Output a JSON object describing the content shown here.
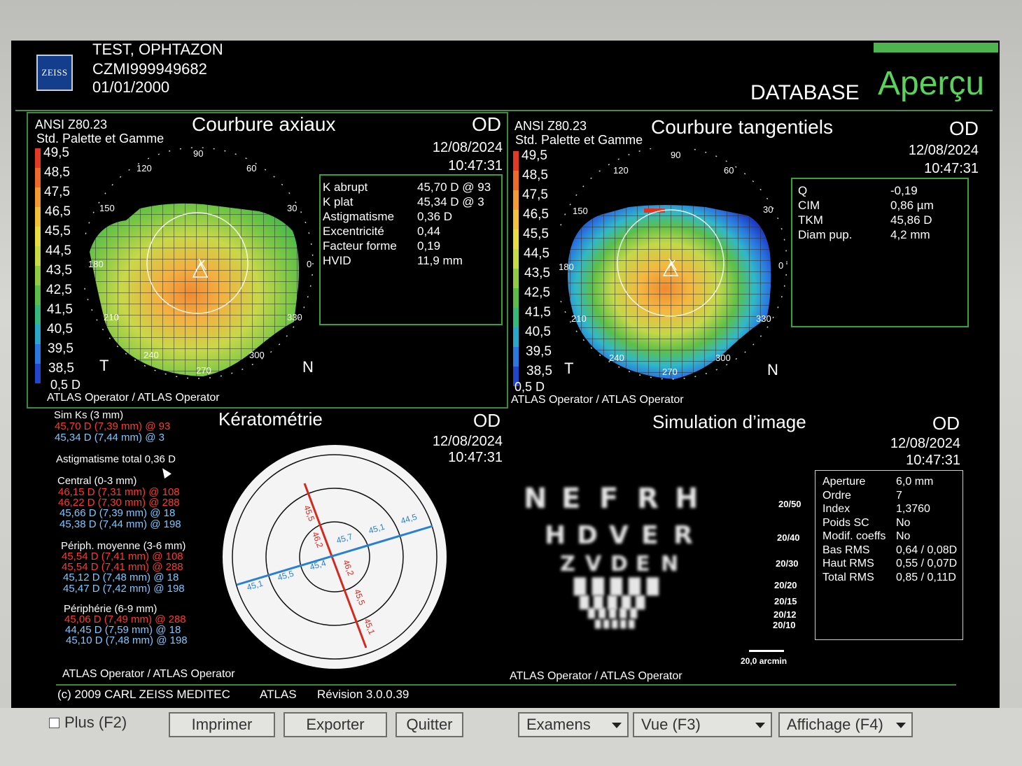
{
  "patient": {
    "name": "TEST, OPHTAZON",
    "id": "CZMI999949682",
    "dob": "01/01/2000"
  },
  "header": {
    "logo": "ZEISS",
    "database": "DATABASE",
    "mode": "Aperçu"
  },
  "axial": {
    "standard": "ANSI Z80.23",
    "palette": "Std. Palette et Gamme",
    "title": "Courbure axiaux",
    "eye": "OD",
    "date": "12/08/2024",
    "time": "10:47:31",
    "scale_labels": [
      "49,5",
      "48,5",
      "47,5",
      "46,5",
      "45,5",
      "44,5",
      "43,5",
      "42,5",
      "41,5",
      "40,5",
      "39,5",
      "38,5"
    ],
    "step": "0,5 D",
    "angles": [
      "90",
      "60",
      "30",
      "0",
      "330",
      "300",
      "270",
      "240",
      "210",
      "180",
      "150",
      "120"
    ],
    "temporal": "T",
    "nasal": "N",
    "info": [
      {
        "label": "K abrupt",
        "value": "45,70 D @ 93"
      },
      {
        "label": "K plat",
        "value": "45,34 D @ 3"
      },
      {
        "label": "Astigmatisme",
        "value": "0,36 D"
      },
      {
        "label": "Excentricité",
        "value": "0,44"
      },
      {
        "label": "Facteur forme",
        "value": "0,19"
      },
      {
        "label": "HVID",
        "value": "11,9 mm"
      }
    ],
    "operator": "ATLAS Operator / ATLAS Operator"
  },
  "tangential": {
    "standard": "ANSI Z80.23",
    "palette": "Std. Palette et Gamme",
    "title": "Courbure tangentiels",
    "eye": "OD",
    "date": "12/08/2024",
    "time": "10:47:31",
    "scale_labels": [
      "49,5",
      "48,5",
      "47,5",
      "46,5",
      "45,5",
      "44,5",
      "43,5",
      "42,5",
      "41,5",
      "40,5",
      "39,5",
      "38,5"
    ],
    "step": "0,5 D",
    "angles": [
      "90",
      "60",
      "30",
      "0",
      "330",
      "300",
      "270",
      "240",
      "210",
      "180",
      "150",
      "120"
    ],
    "temporal": "T",
    "nasal": "N",
    "info": [
      {
        "label": "Q",
        "value": "-0,19"
      },
      {
        "label": "CIM",
        "value": "0,86 µm"
      },
      {
        "label": "TKM",
        "value": "45,86 D"
      },
      {
        "label": "Diam pup.",
        "value": "4,2 mm"
      }
    ],
    "operator": "ATLAS Operator / ATLAS Operator"
  },
  "kerato": {
    "title": "Kératométrie",
    "eye": "OD",
    "date": "12/08/2024",
    "time": "10:47:31",
    "simk_title": "Sim Ks (3 mm)",
    "simk_steep": "45,70 D (7,39 mm) @ 93",
    "simk_flat": "45,34 D (7,44 mm) @ 3",
    "astig_total": "Astigmatisme total 0,36 D",
    "central_title": "Central (0-3 mm)",
    "central": [
      "46,15 D (7,31 mm) @ 108",
      "46,22 D (7,30 mm) @ 288",
      "45,66 D (7,39 mm) @ 18",
      "45,38 D (7,44 mm) @ 198"
    ],
    "periph_mid_title": "Périph. moyenne (3-6 mm)",
    "periph_mid": [
      "45,54 D (7,41 mm) @ 108",
      "45,54 D (7,41 mm) @ 288",
      "45,12 D (7,48 mm) @ 18",
      "45,47 D (7,42 mm) @ 198"
    ],
    "periph_title": "Périphérie (6-9 mm)",
    "periph": [
      "45,06 D (7,49 mm) @ 288",
      "44,45 D (7,59 mm) @ 18",
      "45,10 D (7,48 mm) @ 198"
    ],
    "diagram_labels": {
      "red": [
        "45,5",
        "46,2",
        "46,2",
        "45,5",
        "45,1"
      ],
      "blue": [
        "45,1",
        "45,5",
        "45,4",
        "45,7",
        "45,1",
        "44,5"
      ]
    },
    "operator": "ATLAS Operator / ATLAS Operator"
  },
  "simulation": {
    "title": "Simulation d’image",
    "eye": "OD",
    "date": "12/08/2024",
    "time": "10:47:31",
    "rows": [
      {
        "acuity": "20/50",
        "letters": "NEFRH"
      },
      {
        "acuity": "20/40",
        "letters": "HDVER"
      },
      {
        "acuity": "20/30",
        "letters": "ZVDEN"
      },
      {
        "acuity": "20/20",
        "letters": ""
      },
      {
        "acuity": "20/15",
        "letters": ""
      },
      {
        "acuity": "20/12",
        "letters": ""
      },
      {
        "acuity": "20/10",
        "letters": ""
      }
    ],
    "scale_bar": "20,0 arcmin",
    "info": [
      {
        "label": "Aperture",
        "value": "6,0 mm"
      },
      {
        "label": "Ordre",
        "value": "7"
      },
      {
        "label": "Index",
        "value": "1,3760"
      },
      {
        "label": "Poids SC",
        "value": "No"
      },
      {
        "label": "Modif. coeffs",
        "value": "No"
      },
      {
        "label": "Bas RMS",
        "value": "0,64 / 0,08D"
      },
      {
        "label": "Haut RMS",
        "value": "0,55 / 0,07D"
      },
      {
        "label": "Total RMS",
        "value": "0,85 / 0,11D"
      }
    ],
    "operator": "ATLAS Operator / ATLAS Operator"
  },
  "footer": {
    "copyright": "(c) 2009 CARL ZEISS MEDITEC",
    "product": "ATLAS",
    "revision": "Révision  3.0.0.39"
  },
  "toolbar": {
    "plus": "Plus (F2)",
    "print": "Imprimer",
    "export": "Exporter",
    "quit": "Quitter",
    "exams": "Examens",
    "view": "Vue (F3)",
    "display": "Affichage (F4)"
  },
  "colors": {
    "accent_green": "#5bd25b",
    "steep_red": "#ff3a2a",
    "flat_blue": "#7ec8ff"
  }
}
